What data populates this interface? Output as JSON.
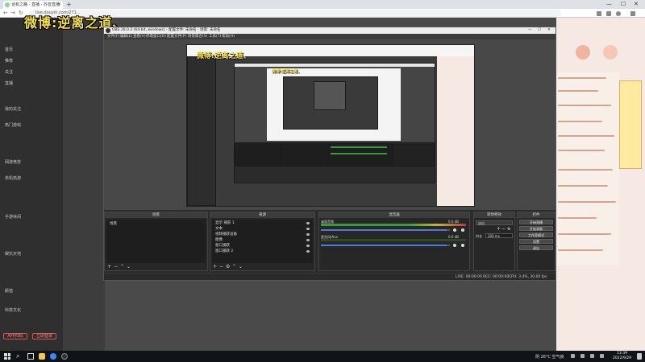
{
  "browser": {
    "tab_title": "诠有之路 - 直播 - 抖音直播",
    "tab_close": "×",
    "new_tab": "+",
    "address": "live.douyin.com/271...",
    "min": "—",
    "max": "☐",
    "close": "✕"
  },
  "overlay_title": "微博:逆离之道、",
  "site_left": {
    "items": [
      "首页",
      "推荐",
      "关注",
      "直播",
      "我的关注",
      "热门游戏",
      "网游竞技",
      "单机热游",
      "手游休闲",
      "娱乐天地",
      "颜值",
      "科技文化"
    ],
    "pills": [
      "APP扫码",
      "立即登录"
    ]
  },
  "obs": {
    "title": "OBS 28.0.3 (64-bit, windows) - 配置文件: 未命名 - 场景: 未命名",
    "menus": [
      "文件(F)",
      "编辑(E)",
      "查看(V)",
      "停靠窗口(D)",
      "配置文件(P)",
      "场景集合(S)",
      "工具(T)",
      "帮助(H)"
    ],
    "nested_title": "微博:逆离之道、",
    "nested_title_2": "微博:逆离之道、",
    "docks": {
      "scenes": {
        "header": "场景",
        "items": [
          "场景"
        ]
      },
      "sources": {
        "header": "来源",
        "items": [
          "显示 捕获 1",
          "文本",
          "视频捕获设备",
          "图像",
          "窗口捕获",
          "窗口捕获 2"
        ]
      },
      "mixer": {
        "header": "混音器",
        "tracks": [
          {
            "label": "桌面音频",
            "db": "0.0 dB"
          },
          {
            "label": "麦克风/Aux",
            "db": "0.0 dB"
          }
        ]
      },
      "transitions": {
        "header": "转场特效",
        "type": "淡出",
        "duration_label": "时长",
        "duration": "300 ms"
      },
      "controls": {
        "header": "控件",
        "buttons": [
          "开始直播",
          "开始录制",
          "工作室模式",
          "设置",
          "退出"
        ]
      }
    },
    "status": {
      "live": "LIVE: 00:00:00",
      "rec": "REC: 00:00:00",
      "cpu": "CPU: 3.4%, 30.00 fps"
    }
  },
  "taskbar": {
    "tray_text": "阴 26°C 空气良",
    "time": "13:39",
    "date": "2022/9/29"
  },
  "colors": {
    "accent_yellow": "#f4e04d",
    "obs_bg": "#2b2b2b",
    "meter_green": "#3c9a3c",
    "slider_blue": "#4f7bd6"
  }
}
